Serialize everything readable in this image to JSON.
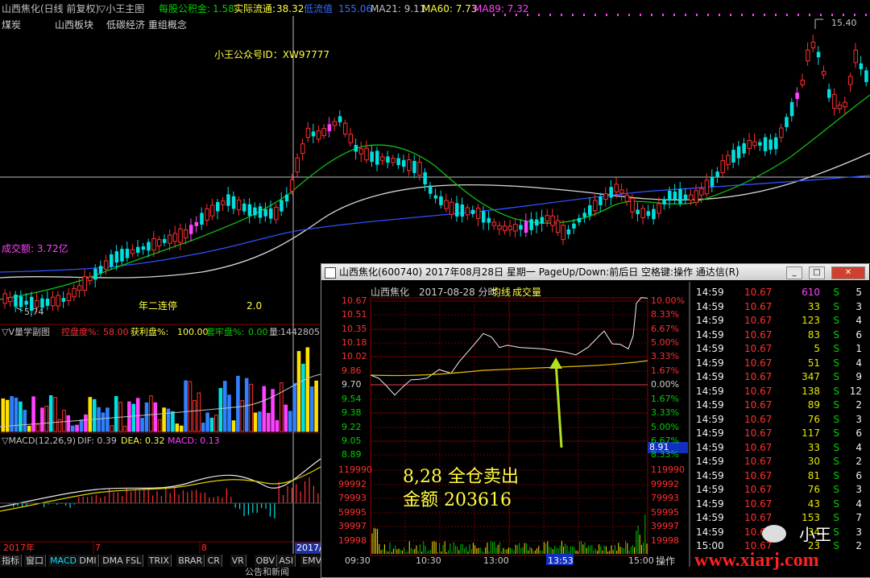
{
  "header": {
    "stock_title": "山西焦化(日线 前复权)",
    "theme_name": "▽小王主图",
    "ind1_label": "每股公积金:",
    "ind1_val": "1.58",
    "ind2_label": "实际流通:",
    "ind2_val": "38.32",
    "ind3_label": "低流值",
    "ind3_val": "155.06",
    "ma21": "MA21: 9.11",
    "ma60": "MA60: 7.73",
    "ma89": "MA89: 7.32"
  },
  "sector": {
    "tag1": "煤炭",
    "tag2": "山西板块",
    "tag3": "低碳经济 重组概念"
  },
  "annotations": {
    "wechat_id": "小王公众号ID：XW97777",
    "turnover": "成交额: 3.72亿",
    "low_price": "5.74",
    "high_price": "15.40",
    "streak": "年二连停",
    "streak_val": "2.0"
  },
  "vol_panel": {
    "title": "▽V量学副图",
    "ctrl_label": "控盘度%:",
    "ctrl_val": "58.00",
    "profit_label": "获利盘%:",
    "profit_val": "100.00",
    "trap_label": "套牢盘%:",
    "trap_val": "0.00",
    "vol_label": "量:",
    "vol_val": "1442805"
  },
  "macd_panel": {
    "title": "▽MACD(12,26,9)",
    "dif": "DIF: 0.39",
    "dea": "DEA: 0.32",
    "macd": "MACD: 0.13"
  },
  "date_axis": {
    "year": "2017年",
    "m7": "7",
    "m8": "8",
    "cursor": "2017/0"
  },
  "bottom_tabs": [
    "指标",
    "窗口",
    "MACD",
    "DMI",
    "DMA",
    "FSL",
    "TRIX",
    "BRAR",
    "CR",
    "VR",
    "OBV",
    "ASI",
    "EMV"
  ],
  "bottom_note": "公告和新闻",
  "popup": {
    "title": "山西焦化(600740)  2017年08月28日 星期一 PageUp/Down:前后日 空格键:操作 通达信(R)",
    "btn_min": "_",
    "btn_max": "□",
    "btn_close": "✕",
    "chart_name": "山西焦化",
    "chart_date": "2017-08-28 分时",
    "legend_avg": "均线",
    "legend_vol": "成交量",
    "price_labels": [
      "10.67",
      "10.51",
      "10.35",
      "10.18",
      "10.02",
      "9.86",
      "9.70",
      "9.54",
      "9.38",
      "9.22",
      "9.05",
      "8.89"
    ],
    "pct_labels": [
      "10.00%",
      "8.33%",
      "6.67%",
      "5.00%",
      "3.33%",
      "1.67%",
      "0.00%",
      "1.67%",
      "3.33%",
      "5.00%",
      "6.67%",
      "8.33%"
    ],
    "cursor_price": "8.91",
    "vol_labels": [
      "119990",
      "99992",
      "79993",
      "59995",
      "39997",
      "19998"
    ],
    "time_labels": [
      "09:30",
      "10:30",
      "13:00",
      "13:53",
      "15:00"
    ],
    "ops_label": "操作",
    "note_line1": "8,28  全仓卖出",
    "note_line2": "金额  203616",
    "ticks": [
      {
        "t": "14:59",
        "p": "10.67",
        "v": "610",
        "s": "S",
        "n": "5"
      },
      {
        "t": "14:59",
        "p": "10.67",
        "v": "33",
        "s": "S",
        "n": "3"
      },
      {
        "t": "14:59",
        "p": "10.67",
        "v": "123",
        "s": "S",
        "n": "4"
      },
      {
        "t": "14:59",
        "p": "10.67",
        "v": "83",
        "s": "S",
        "n": "6"
      },
      {
        "t": "14:59",
        "p": "10.67",
        "v": "5",
        "s": "S",
        "n": "1"
      },
      {
        "t": "14:59",
        "p": "10.67",
        "v": "51",
        "s": "S",
        "n": "4"
      },
      {
        "t": "14:59",
        "p": "10.67",
        "v": "347",
        "s": "S",
        "n": "9"
      },
      {
        "t": "14:59",
        "p": "10.67",
        "v": "138",
        "s": "S",
        "n": "12"
      },
      {
        "t": "14:59",
        "p": "10.67",
        "v": "89",
        "s": "S",
        "n": "2"
      },
      {
        "t": "14:59",
        "p": "10.67",
        "v": "76",
        "s": "S",
        "n": "3"
      },
      {
        "t": "14:59",
        "p": "10.67",
        "v": "117",
        "s": "S",
        "n": "6"
      },
      {
        "t": "14:59",
        "p": "10.67",
        "v": "33",
        "s": "S",
        "n": "4"
      },
      {
        "t": "14:59",
        "p": "10.67",
        "v": "30",
        "s": "S",
        "n": "2"
      },
      {
        "t": "14:59",
        "p": "10.67",
        "v": "81",
        "s": "S",
        "n": "6"
      },
      {
        "t": "14:59",
        "p": "10.67",
        "v": "76",
        "s": "S",
        "n": "3"
      },
      {
        "t": "14:59",
        "p": "10.67",
        "v": "43",
        "s": "S",
        "n": "4"
      },
      {
        "t": "14:59",
        "p": "10.67",
        "v": "153",
        "s": "S",
        "n": "7"
      },
      {
        "t": "14:59",
        "p": "10.67",
        "v": "34",
        "s": "S",
        "n": "3"
      },
      {
        "t": "15:00",
        "p": "10.67",
        "v": "23",
        "s": "S",
        "n": "2"
      }
    ]
  },
  "watermark": {
    "name": "小王",
    "site": "www.xiarj.com"
  },
  "colors": {
    "red": "#ff3030",
    "green": "#00d000",
    "yellow": "#ffff00",
    "magenta": "#ff40ff",
    "cyan": "#00e0ff"
  }
}
